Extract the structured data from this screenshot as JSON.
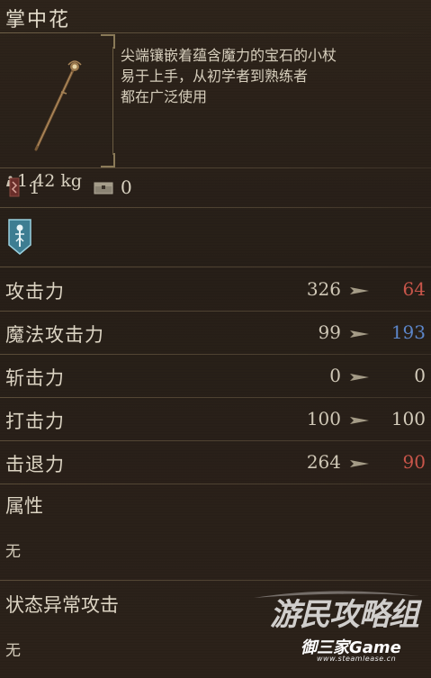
{
  "item": {
    "name": "掌中花",
    "weight": "1.42 kg",
    "description": [
      "尖端镶嵌着蕴含魔力的宝石的小杖",
      "易于上手，从初学者到熟练者",
      "都在广泛使用"
    ]
  },
  "requirements": {
    "slot_a_value": "1",
    "slot_b_value": "0"
  },
  "stats": [
    {
      "label": "攻击力",
      "base": "326",
      "new": "64",
      "new_color": "#c8554a"
    },
    {
      "label": "魔法攻击力",
      "base": "99",
      "new": "193",
      "new_color": "#5c86c9"
    },
    {
      "label": "斩击力",
      "base": "0",
      "new": "0",
      "new_color": "#d4ccbb"
    },
    {
      "label": "打击力",
      "base": "100",
      "new": "100",
      "new_color": "#d4ccbb"
    },
    {
      "label": "击退力",
      "base": "264",
      "new": "90",
      "new_color": "#c8554a"
    }
  ],
  "attribute": {
    "label": "属性",
    "value": "无"
  },
  "status_effect": {
    "label": "状态异常攻击",
    "value": "无"
  },
  "watermark": {
    "main": "游民攻略组",
    "brand": "御三家Game",
    "url": "www.steamlease.cn"
  },
  "icons": [
    "weight-icon",
    "requirement-icon",
    "storage-chest-icon",
    "skill-icon",
    "upgrade-arrow-icon"
  ]
}
